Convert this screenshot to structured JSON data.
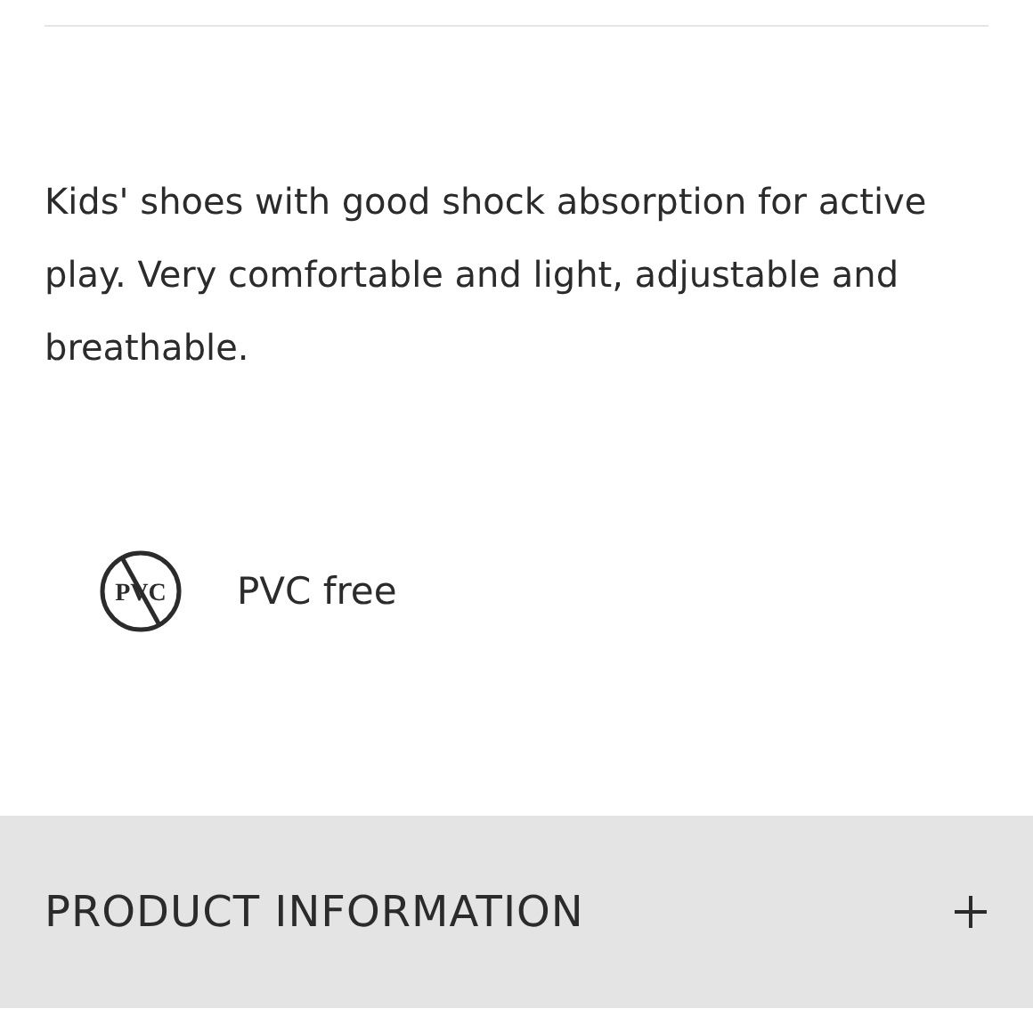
{
  "description": "Kids' shoes with good shock absorption for active play. Very comfortable and light, adjustable and breathable.",
  "features": [
    {
      "icon_text": "PVC",
      "label": "PVC free"
    }
  ],
  "sections": [
    {
      "title": "PRODUCT INFORMATION",
      "expanded": false
    }
  ]
}
